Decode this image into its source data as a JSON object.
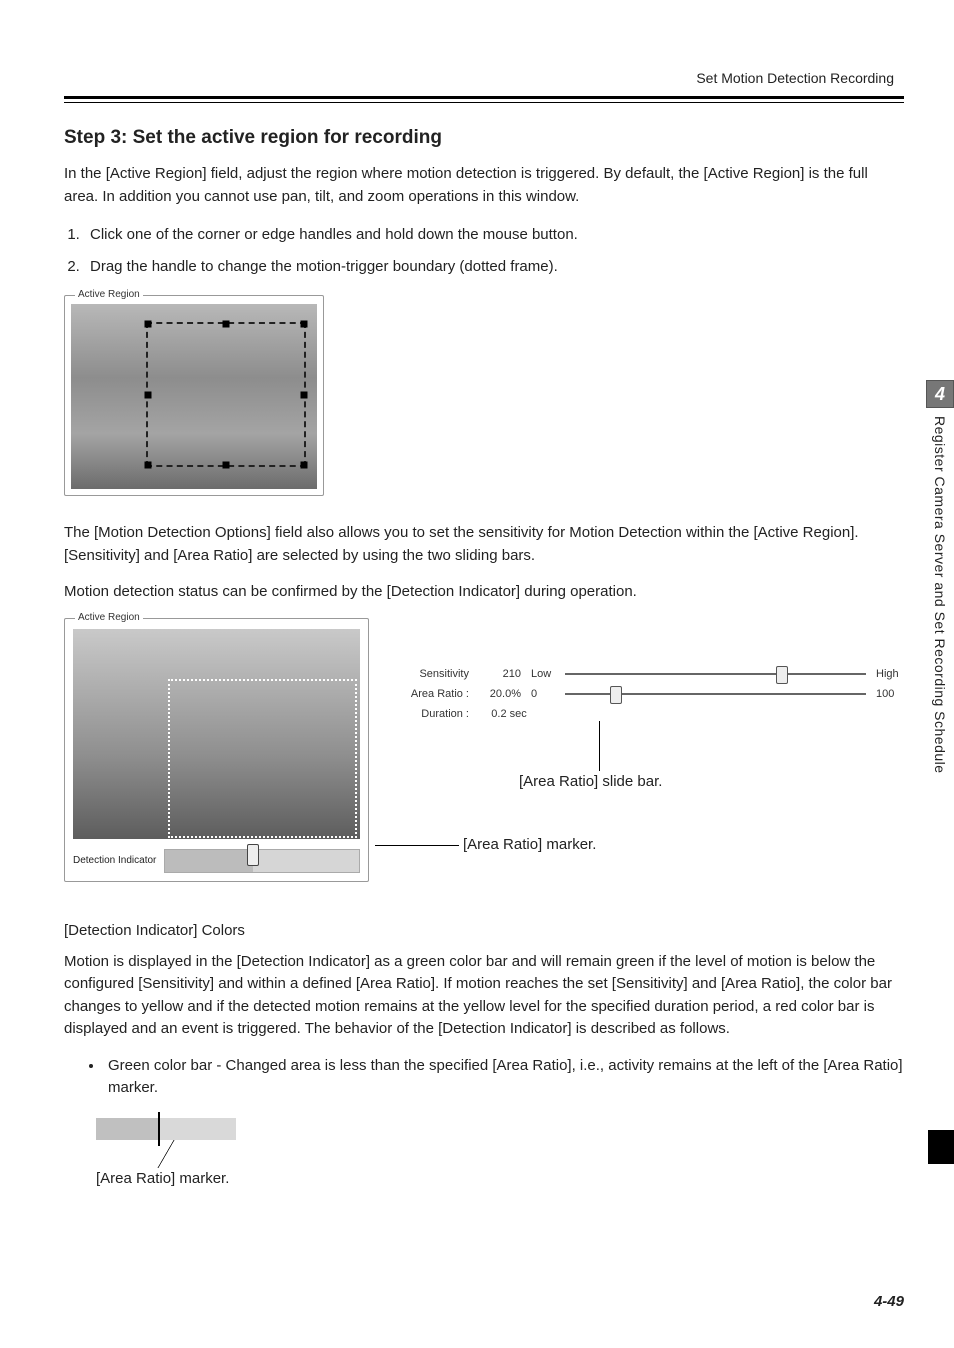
{
  "header": {
    "running_title": "Set Motion Detection Recording"
  },
  "step": {
    "title": "Step 3: Set the active region for recording",
    "intro": "In the [Active Region] field, adjust the region where motion detection is triggered. By default, the [Active Region] is the full area. In addition you cannot use pan, tilt, and zoom operations in this window.",
    "items": [
      "Click one of the corner or edge handles and hold down the mouse button.",
      "Drag the handle to change the motion-trigger boundary (dotted frame)."
    ]
  },
  "fig1": {
    "legend": "Active Region"
  },
  "para2a": "The [Motion Detection Options] field also allows you to set the sensitivity for Motion Detection within the [Active Region]. [Sensitivity] and [Area Ratio] are selected by using the two sliding bars.",
  "para2b": "Motion detection status can be confirmed by the [Detection Indicator] during operation.",
  "fig2": {
    "legend": "Active Region",
    "detection_label": "Detection Indicator",
    "settings": {
      "sensitivity": {
        "label": "Sensitivity",
        "value": "210",
        "low": "Low",
        "high": "High"
      },
      "area_ratio": {
        "label": "Area Ratio :",
        "value": "20.0%",
        "low": "0",
        "high": "100"
      },
      "duration": {
        "label": "Duration :",
        "value": "0.2 sec"
      }
    },
    "callout_slide": "[Area Ratio] slide bar.",
    "callout_marker": "[Area Ratio] marker."
  },
  "colors": {
    "heading": "[Detection Indicator] Colors",
    "para": "Motion is displayed in the [Detection Indicator] as a green color bar and will remain green if the level of motion is below the configured [Sensitivity] and within a defined [Area Ratio]. If motion reaches the set [Sensitivity] and [Area Ratio], the color bar changes to yellow and if the detected motion remains at the yellow level for the specified duration period, a red color bar is displayed and an event is triggered. The behavior of the [Detection Indicator] is described as follows.",
    "bullet": "Green color bar - Changed area is less than the specified [Area Ratio], i.e., activity remains at the left of the [Area Ratio] marker.",
    "marker_caption": "[Area Ratio] marker."
  },
  "tab": {
    "number": "4",
    "text": "Register Camera Server and Set Recording Schedule"
  },
  "footer": {
    "page_number": "4-49"
  }
}
